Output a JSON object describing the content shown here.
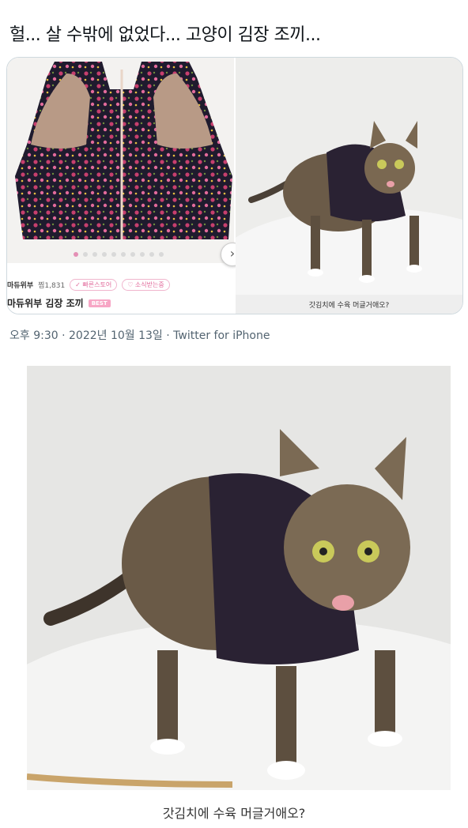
{
  "tweet": {
    "text": "헐... 살 수밖에 없었다... 고양이 김장 조끼..."
  },
  "media_left": {
    "shop_name": "마듀위부",
    "shop_count": "찜1,831",
    "pill1": "✓ 빠른스토어",
    "pill2": "♡ 소식받는중",
    "product_name": "마듀위부 김장 조끼",
    "badge": "BEST",
    "dots_total": 10,
    "dots_active": 1
  },
  "media_right": {
    "caption": "갓김치에 수육 머글거애오?"
  },
  "meta": {
    "line": "오후 9:30 · 2022년 10월 13일 · Twitter for iPhone"
  },
  "big_image": {
    "caption": "갓김치에 수육 머글거애오?"
  },
  "colors": {
    "accent_pink": "#e48fb5",
    "meta_gray": "#536471",
    "vest_dark": "#1f1b2e",
    "vest_flower": "#c73f6e"
  },
  "icons": {
    "next_arrow": "chevron-right-icon"
  }
}
